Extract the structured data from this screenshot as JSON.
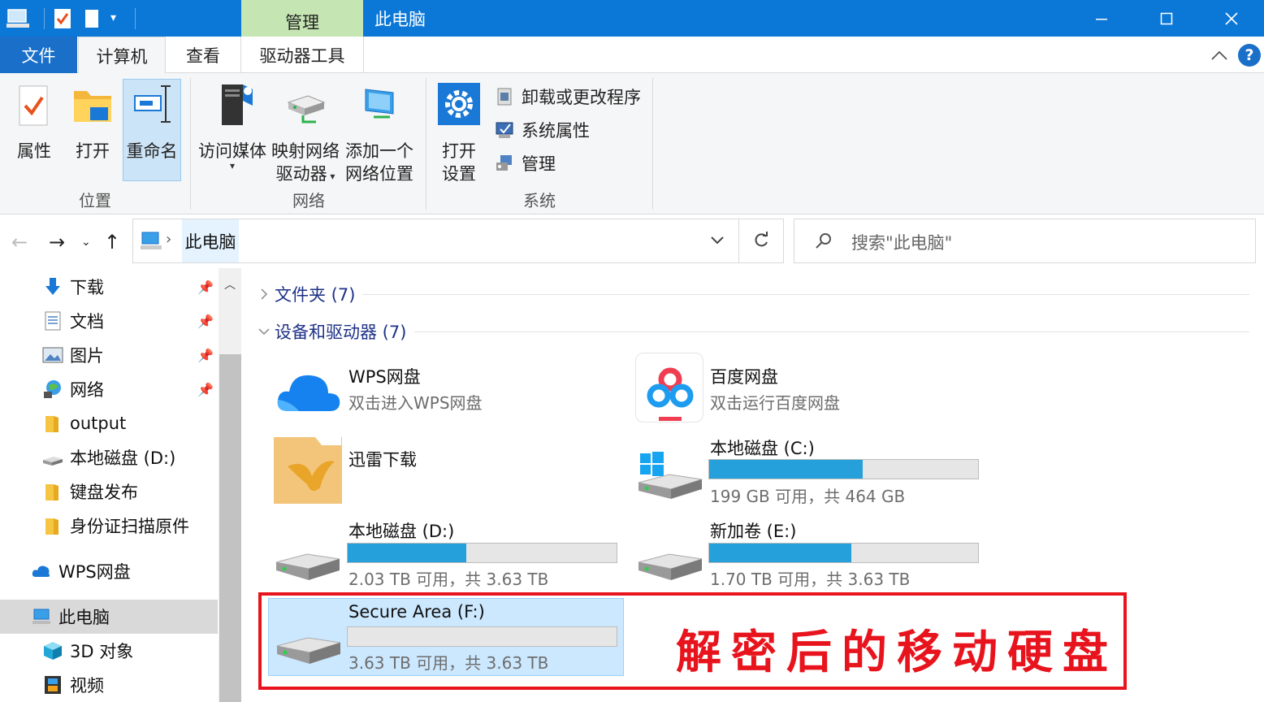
{
  "titlebar": {
    "context_tab": "管理",
    "window_title": "此电脑"
  },
  "tabs": {
    "file": "文件",
    "computer": "计算机",
    "view": "查看",
    "drive_tools": "驱动器工具"
  },
  "ribbon": {
    "properties": "属性",
    "open": "打开",
    "rename": "重命名",
    "group_location": "位置",
    "access_media": "访问媒体",
    "map_drive_l1": "映射网络",
    "map_drive_l2": "驱动器",
    "add_net_l1": "添加一个",
    "add_net_l2": "网络位置",
    "group_network": "网络",
    "open_settings_l1": "打开",
    "open_settings_l2": "设置",
    "uninstall": "卸载或更改程序",
    "sys_props": "系统属性",
    "manage": "管理",
    "group_system": "系统"
  },
  "address": {
    "path": "此电脑",
    "search_placeholder": "搜索\"此电脑\""
  },
  "sidebar": {
    "items": [
      "下载",
      "文档",
      "图片",
      "网络",
      "output",
      "本地磁盘 (D:)",
      "键盘发布",
      "身份证扫描原件",
      "WPS网盘",
      "此电脑",
      "3D 对象",
      "视频"
    ]
  },
  "content": {
    "folders_header": "文件夹 (7)",
    "devices_header": "设备和驱动器 (7)",
    "wps_name": "WPS网盘",
    "wps_sub": "双击进入WPS网盘",
    "baidu_name": "百度网盘",
    "baidu_sub": "双击运行百度网盘",
    "xunlei_name": "迅雷下载",
    "c_name": "本地磁盘 (C:)",
    "c_sub": "199 GB 可用，共 464 GB",
    "c_used": 0.571,
    "d_name": "本地磁盘 (D:)",
    "d_sub": "2.03 TB 可用，共 3.63 TB",
    "d_used": 0.44,
    "e_name": "新加卷 (E:)",
    "e_sub": "1.70 TB 可用，共 3.63 TB",
    "e_used": 0.53,
    "f_name": "Secure Area (F:)",
    "f_sub": "3.63 TB 可用，共 3.63 TB",
    "f_used": 0.0,
    "annotation": "解密后的移动硬盘"
  },
  "colors": {
    "accent": "#0b78d7",
    "context": "#c5e6b3",
    "bar": "#26a0da",
    "selected": "#cce8ff",
    "annotation": "#e8141d"
  }
}
